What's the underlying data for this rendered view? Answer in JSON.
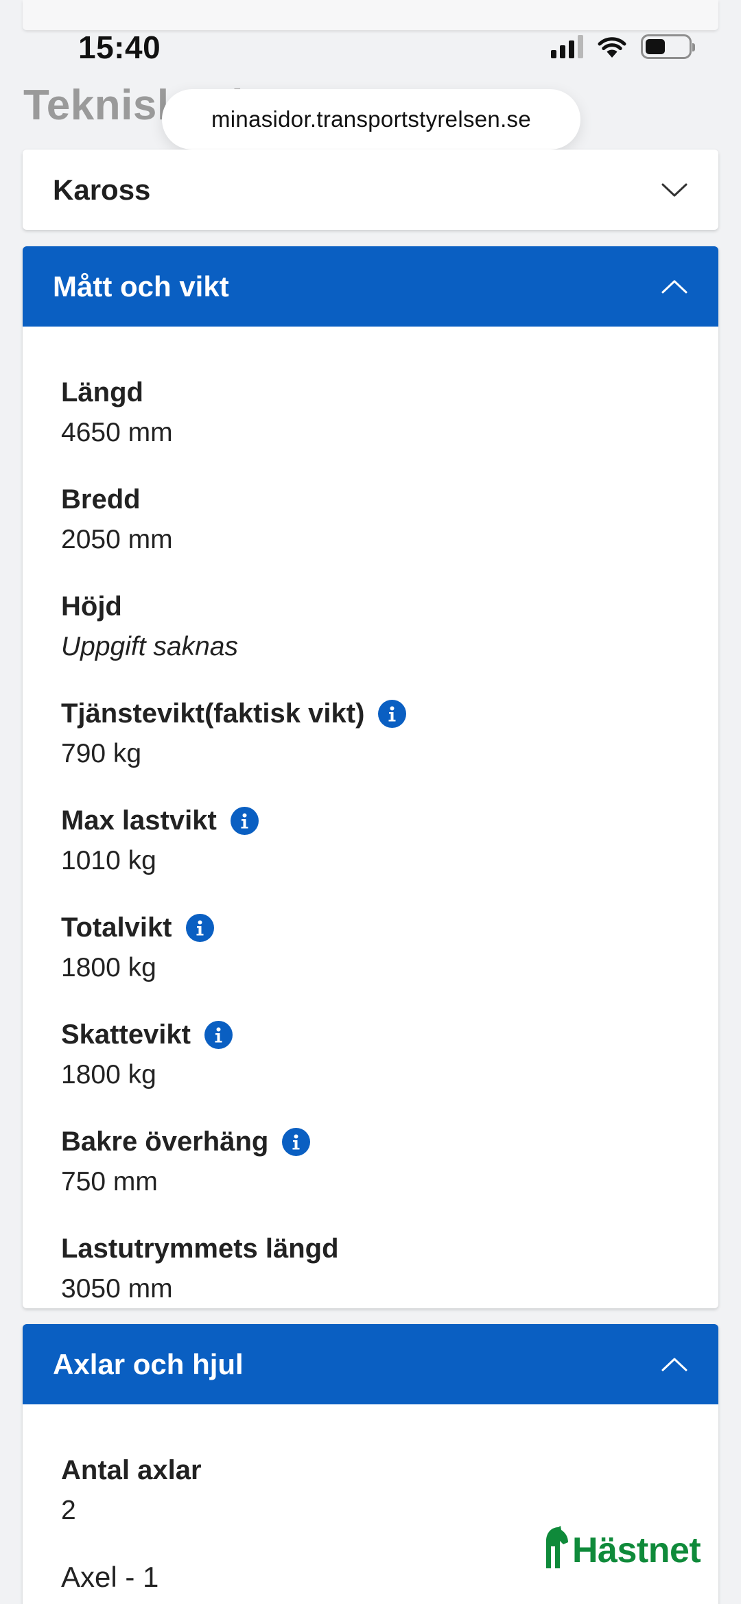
{
  "status_bar": {
    "time": "15:40"
  },
  "page_heading": "Tekniska data",
  "browser": {
    "url": "minasidor.transportstyrelsen.se"
  },
  "sections": {
    "kaross": {
      "title": "Kaross",
      "expanded": false
    },
    "matt_och_vikt": {
      "title": "Mått och vikt",
      "expanded": true,
      "fields": [
        {
          "label": "Längd",
          "value": "4650 mm",
          "info": false
        },
        {
          "label": "Bredd",
          "value": "2050 mm",
          "info": false
        },
        {
          "label": "Höjd",
          "value": "Uppgift saknas",
          "info": false,
          "missing": true
        },
        {
          "label": "Tjänstevikt(faktisk vikt)",
          "value": "790 kg",
          "info": true
        },
        {
          "label": "Max lastvikt",
          "value": "1010 kg",
          "info": true
        },
        {
          "label": "Totalvikt",
          "value": "1800 kg",
          "info": true
        },
        {
          "label": "Skattevikt",
          "value": "1800 kg",
          "info": true
        },
        {
          "label": "Bakre överhäng",
          "value": "750 mm",
          "info": true
        },
        {
          "label": "Lastutrymmets längd",
          "value": "3050 mm",
          "info": false
        }
      ]
    },
    "axlar_och_hjul": {
      "title": "Axlar och hjul",
      "expanded": true,
      "fields": [
        {
          "label": "Antal axlar",
          "value": "2"
        }
      ],
      "subheading": "Axel - 1"
    }
  },
  "watermark": {
    "text": "Hästnet",
    "color": "#0f8a3a"
  },
  "colors": {
    "accent": "#0a5fc2",
    "background": "#f1f2f4"
  }
}
